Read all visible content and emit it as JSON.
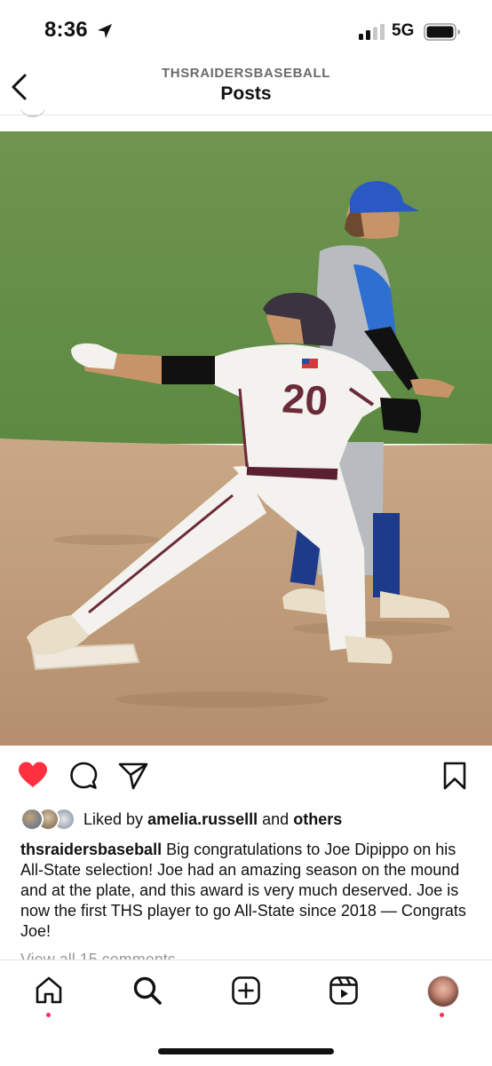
{
  "status_bar": {
    "time": "8:36",
    "network": "5G"
  },
  "header": {
    "account": "THSRAIDERSBASEBALL",
    "title": "Posts"
  },
  "post": {
    "photo": {
      "jersey_number": "20"
    },
    "actions": {
      "liked": true,
      "like_color": "#ff3040"
    },
    "likes": {
      "prefix": "Liked by",
      "user": "amelia.russelll",
      "joiner": "and",
      "others": "others"
    },
    "caption": {
      "username": "thsraidersbaseball",
      "text": "Big congratulations to Joe Dipippo on his All-State selection! Joe had an amazing season on the mound and at the plate, and this award is very much deserved. Joe is now the first THS player to go All-State since 2018 — Congrats Joe!"
    },
    "view_comments": "View all 15 comments"
  },
  "tab_bar": {
    "icons": [
      "home-icon",
      "search-icon",
      "create-icon",
      "reels-icon",
      "profile-avatar"
    ],
    "notification_color": "#ff2d55"
  }
}
